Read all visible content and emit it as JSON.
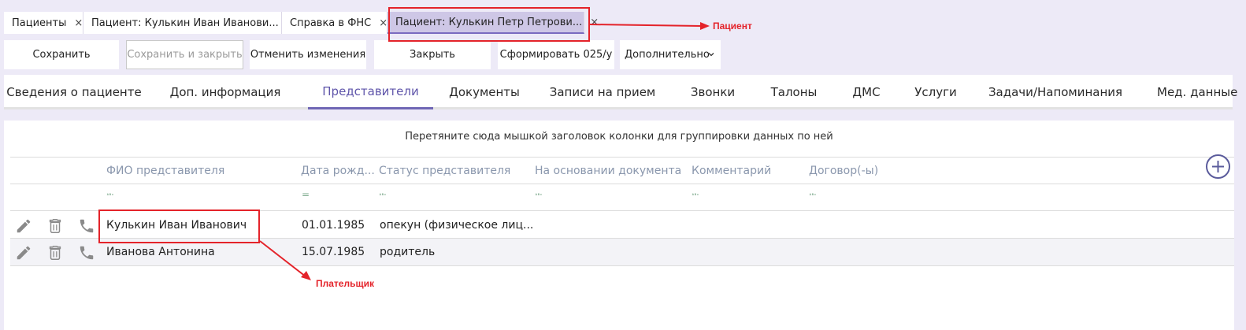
{
  "doc_tabs": [
    {
      "label": "Пациенты",
      "close": "×"
    },
    {
      "label": "Пациент: Кулькин Иван Иванови...",
      "close": "×"
    },
    {
      "label": "Справка в ФНС",
      "close": "×"
    },
    {
      "label": "Пациент: Кулькин Петр Петрови...",
      "close": "×"
    }
  ],
  "toolbar": {
    "save": "Сохранить",
    "save_close": "Сохранить и закрыть",
    "cancel_changes": "Отменить изменения",
    "close": "Закрыть",
    "form_025": "Сформировать 025/у",
    "more": "Дополнительно"
  },
  "section_tabs": [
    "Сведения о пациенте",
    "Доп. информация",
    "Представители",
    "Документы",
    "Записи на прием",
    "Звонки",
    "Талоны",
    "ДМС",
    "Услуги",
    "Задачи/Напоминания",
    "Мед. данные"
  ],
  "active_section": "Представители",
  "grid": {
    "group_hint": "Перетяните сюда мышкой заголовок колонки для группировки данных по ней",
    "columns": [
      "ФИО представителя",
      "Дата рожд...",
      "Статус представителя",
      "На основании документа",
      "Комментарий",
      "Договор(-ы)"
    ],
    "filter_text_icon": "ᴬᴮᶜ",
    "filter_eq_icon": "=",
    "rows": [
      {
        "name": "Кулькин Иван Иванович",
        "birth_date": "01.01.1985",
        "status": "опекун (физическое лиц...",
        "basis_doc": "",
        "comment": "",
        "contracts": ""
      },
      {
        "name": "Иванова Антонина",
        "birth_date": "15.07.1985",
        "status": "родитель",
        "basis_doc": "",
        "comment": "",
        "contracts": ""
      }
    ]
  },
  "annotations": {
    "patient_label": "Пациент",
    "payer_label": "Плательщик",
    "color": "#e4232a"
  },
  "colors": {
    "accent": "#6f66b5",
    "background": "#edeaf7",
    "active_doc_tab": "#cec7e6",
    "header_text": "#8a97ad",
    "icon_gray": "#8a8a8a"
  }
}
